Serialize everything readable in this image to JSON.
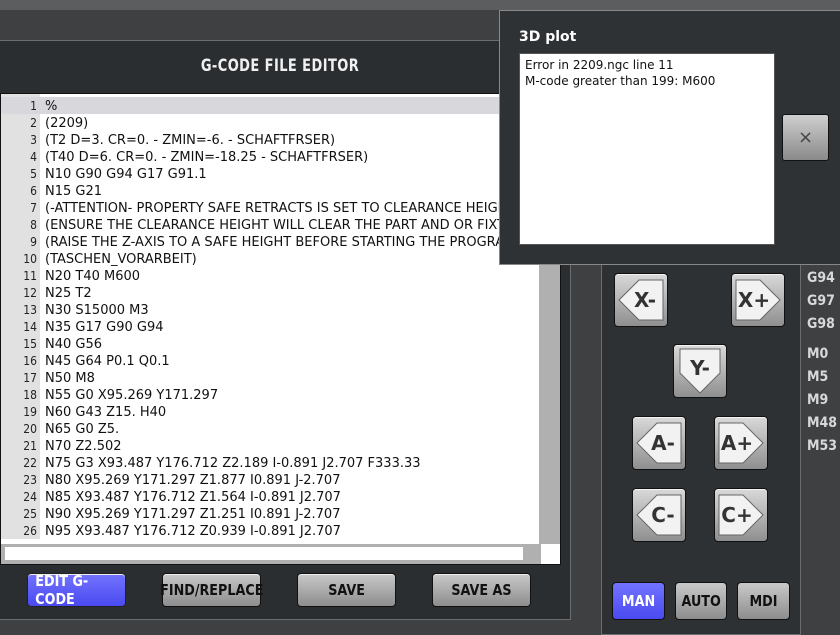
{
  "editor": {
    "title": "G-CODE FILE EDITOR",
    "current_line": 1,
    "lines": [
      {
        "num": "1",
        "text": "%"
      },
      {
        "num": "2",
        "text": "(2209)"
      },
      {
        "num": "3",
        "text": "(T2 D=3. CR=0. - ZMIN=-6. - SCHAFTFRSER)"
      },
      {
        "num": "4",
        "text": "(T40 D=6. CR=0. - ZMIN=-18.25 - SCHAFTFRSER)"
      },
      {
        "num": "5",
        "text": "N10 G90 G94 G17 G91.1"
      },
      {
        "num": "6",
        "text": "N15 G21"
      },
      {
        "num": "7",
        "text": "(-ATTENTION- PROPERTY SAFE RETRACTS IS SET TO CLEARANCE HEIGHT)"
      },
      {
        "num": "8",
        "text": "(ENSURE THE CLEARANCE HEIGHT WILL CLEAR THE PART AND OR FIXTURES)"
      },
      {
        "num": "9",
        "text": "(RAISE THE Z-AXIS TO A SAFE HEIGHT BEFORE STARTING THE PROGRAM)"
      },
      {
        "num": "10",
        "text": "(TASCHEN_VORARBEIT)"
      },
      {
        "num": "11",
        "text": "N20 T40 M600"
      },
      {
        "num": "12",
        "text": "N25 T2"
      },
      {
        "num": "13",
        "text": "N30 S15000 M3"
      },
      {
        "num": "14",
        "text": "N35 G17 G90 G94"
      },
      {
        "num": "15",
        "text": "N40 G56"
      },
      {
        "num": "16",
        "text": "N45 G64 P0.1 Q0.1"
      },
      {
        "num": "17",
        "text": "N50 M8"
      },
      {
        "num": "18",
        "text": "N55 G0 X95.269 Y171.297"
      },
      {
        "num": "19",
        "text": "N60 G43 Z15. H40"
      },
      {
        "num": "20",
        "text": "N65 G0 Z5."
      },
      {
        "num": "21",
        "text": "N70 Z2.502"
      },
      {
        "num": "22",
        "text": "N75 G3 X93.487 Y176.712 Z2.189 I-0.891 J2.707 F333.33"
      },
      {
        "num": "23",
        "text": "N80 X95.269 Y171.297 Z1.877 I0.891 J-2.707"
      },
      {
        "num": "24",
        "text": "N85 X93.487 Y176.712 Z1.564 I-0.891 J2.707"
      },
      {
        "num": "25",
        "text": "N90 X95.269 Y171.297 Z1.251 I0.891 J-2.707"
      },
      {
        "num": "26",
        "text": "N95 X93.487 Y176.712 Z0.939 I-0.891 J2.707"
      }
    ],
    "buttons": {
      "edit_gcode": "EDIT G-CODE",
      "find_replace": "FIND/REPLACE",
      "save": "SAVE",
      "save_as": "SAVE AS"
    }
  },
  "dialog": {
    "title": "3D plot",
    "message_line1": "Error in 2209.ngc line 11",
    "message_line2": "M-code greater than 199: M600",
    "close_label": "×"
  },
  "jog": {
    "x_minus": "X-",
    "x_plus": "X+",
    "y_minus": "Y-",
    "a_minus": "A-",
    "a_plus": "A+",
    "c_minus": "C-",
    "c_plus": "C+"
  },
  "active_gcodes": [
    "G94",
    "G97",
    "G98"
  ],
  "active_mcodes": [
    "M0",
    "M5",
    "M9",
    "M48",
    "M53"
  ],
  "modes": {
    "man": "MAN",
    "auto": "AUTO",
    "mdi": "MDI",
    "active": "MAN"
  },
  "colors": {
    "accent": "#5a5af5",
    "panel_bg": "#2e3133"
  }
}
